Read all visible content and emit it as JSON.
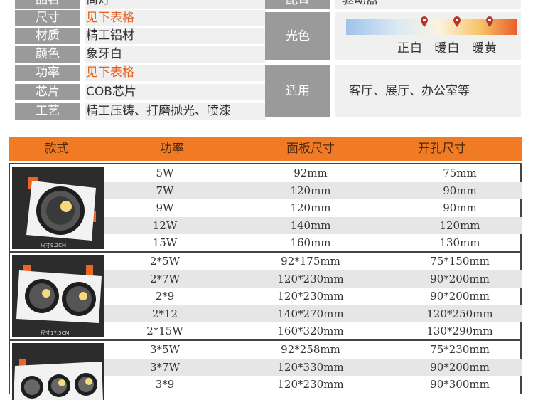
{
  "spec": {
    "rows": [
      {
        "label": "品名",
        "value": "筒灯",
        "highlight": false
      },
      {
        "label": "尺寸",
        "value": "见下表格",
        "highlight": true
      },
      {
        "label": "材质",
        "value": "精工铝材",
        "highlight": false
      },
      {
        "label": "颜色",
        "value": "象牙白",
        "highlight": false
      },
      {
        "label": "功率",
        "value": "见下表格",
        "highlight": true
      },
      {
        "label": "芯片",
        "value": "COB芯片",
        "highlight": false
      },
      {
        "label": "工艺",
        "value": "精工压铸、打磨抛光、喷漆",
        "highlight": false
      }
    ],
    "right": {
      "top_label": "配置",
      "top_value": "驱动器",
      "color_label": "光色",
      "color_temps": [
        "正白",
        "暖白",
        "暖黄"
      ],
      "use_label": "适用",
      "use_value": "客厅、展厅、办公室等"
    }
  },
  "table": {
    "headers": [
      "款式",
      "功率",
      "面板尺寸",
      "开孔尺寸"
    ],
    "groups": [
      {
        "photo_caption": "尺寸9.2CM",
        "rows": [
          {
            "power": "5W",
            "panel": "92mm",
            "hole": "75mm"
          },
          {
            "power": "7W",
            "panel": "120mm",
            "hole": "90mm"
          },
          {
            "power": "9W",
            "panel": "120mm",
            "hole": "90mm"
          },
          {
            "power": "12W",
            "panel": "140mm",
            "hole": "120mm"
          },
          {
            "power": "15W",
            "panel": "160mm",
            "hole": "130mm"
          }
        ]
      },
      {
        "photo_caption": "尺寸17.5CM",
        "rows": [
          {
            "power": "2*5W",
            "panel": "92*175mm",
            "hole": "75*150mm"
          },
          {
            "power": "2*7W",
            "panel": "120*230mm",
            "hole": "90*200mm"
          },
          {
            "power": "2*9",
            "panel": "120*230mm",
            "hole": "90*200mm"
          },
          {
            "power": "2*12",
            "panel": "140*270mm",
            "hole": "120*250mm"
          },
          {
            "power": "2*15W",
            "panel": "160*320mm",
            "hole": "130*290mm"
          }
        ]
      },
      {
        "photo_caption": "",
        "rows": [
          {
            "power": "3*5W",
            "panel": "92*258mm",
            "hole": "75*230mm"
          },
          {
            "power": "3*7W",
            "panel": "120*330mm",
            "hole": "90*200mm"
          },
          {
            "power": "3*9",
            "panel": "120*230mm",
            "hole": "90*300mm"
          }
        ]
      }
    ]
  }
}
